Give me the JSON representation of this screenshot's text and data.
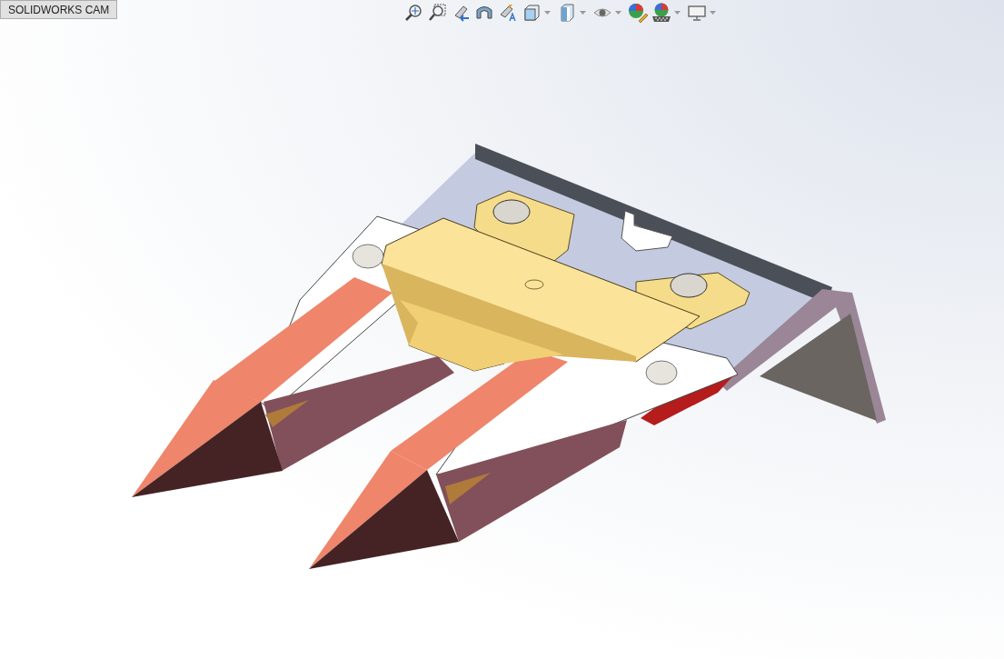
{
  "tab": {
    "label": "SOLIDWORKS CAM"
  },
  "toolbar": {
    "items": [
      {
        "kind": "zoom-fit",
        "dropdown": false
      },
      {
        "kind": "zoom-area",
        "dropdown": false
      },
      {
        "kind": "previous-view",
        "dropdown": false
      },
      {
        "kind": "section-view",
        "dropdown": false
      },
      {
        "kind": "dynamic-annotation",
        "dropdown": false
      },
      {
        "kind": "view-orientation",
        "dropdown": true
      },
      {
        "kind": "display-style",
        "dropdown": true
      },
      {
        "kind": "hide-show",
        "dropdown": true
      },
      {
        "kind": "edit-appearance",
        "dropdown": false
      },
      {
        "kind": "apply-scene",
        "dropdown": true
      },
      {
        "kind": "view-settings",
        "dropdown": true
      }
    ]
  }
}
